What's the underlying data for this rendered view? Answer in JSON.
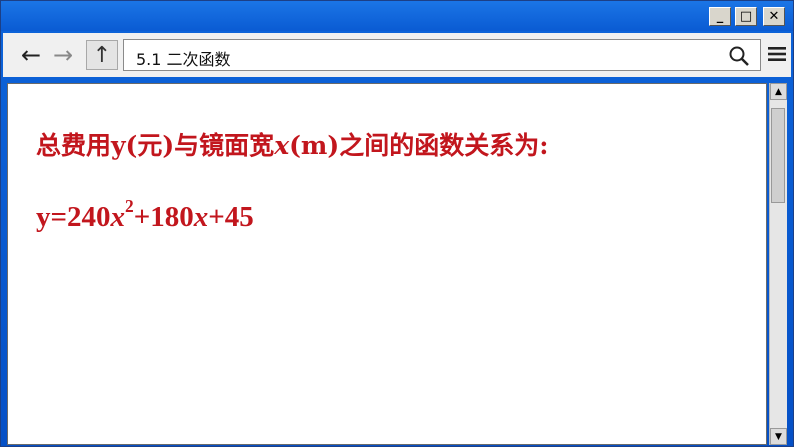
{
  "window": {
    "controls": {
      "minimize": "_",
      "maximize": "□",
      "close": "✕"
    }
  },
  "toolbar": {
    "back_icon": "←",
    "forward_icon": "→",
    "up_icon": "↑",
    "address": "5.1 二次函数",
    "search_icon": "search-icon",
    "menu_icon": "menu-icon"
  },
  "content": {
    "line1_prefix": "总费用y(元)与镜面宽",
    "line1_var": "x",
    "line1_suffix": "(m)之间的函数关系为:",
    "eq_part1": "y=240",
    "eq_var1": "x",
    "eq_exp": "2",
    "eq_part2": "+180",
    "eq_var2": "x",
    "eq_part3": "+45"
  },
  "scrollbar": {
    "up": "▲",
    "down": "▼"
  },
  "colors": {
    "text": "#c2161d",
    "titlebar": "#0a5bd3"
  }
}
